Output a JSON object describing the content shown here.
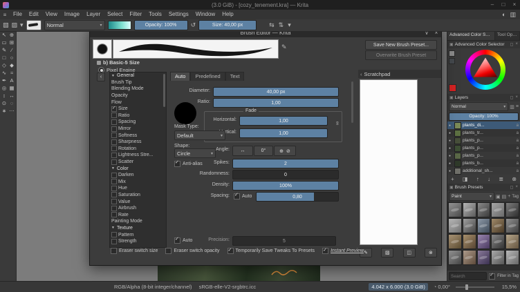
{
  "window": {
    "title": "(3.0 GiB) - [cozy_tenement.kra] — Krita",
    "controls": [
      {
        "glyph": "–",
        "name": "minimize"
      },
      {
        "glyph": "□",
        "name": "maximize"
      },
      {
        "glyph": "×",
        "name": "close"
      }
    ]
  },
  "menubar": {
    "items": [
      "File",
      "Edit",
      "View",
      "Image",
      "Layer",
      "Select",
      "Filter",
      "Tools",
      "Settings",
      "Window",
      "Help"
    ],
    "right_icons": [
      "◐",
      "▥"
    ]
  },
  "toolbar": {
    "left_icons": [
      "▧",
      "▨",
      "▾"
    ],
    "blend_mode": "Normal",
    "opacity_label": "Opacity: 100%",
    "opacity_fill": "100%",
    "size_label": "Size: 40,00 px",
    "size_fill": "100%",
    "right_icons": [
      "⇆",
      "⇅",
      "▾"
    ]
  },
  "toolbox": {
    "tools": [
      "↖",
      "⊕",
      "▭",
      "⊞",
      "✎",
      "∕",
      "□",
      "○",
      "◇",
      "◆",
      "∿",
      "≈",
      "✒",
      "A",
      "◎",
      "▦",
      "↕",
      "↔",
      "⊙",
      "◌",
      "∗",
      "⋯"
    ]
  },
  "dialog": {
    "title": "Brush Editor — Krita",
    "titlebar_icons": [
      {
        "glyph": "∨",
        "name": "detach"
      },
      {
        "glyph": "×",
        "name": "close"
      }
    ],
    "preset_name": "b) Basic-5 Size",
    "engine": "Pixel Engine",
    "save_button": "Save New Brush Preset...",
    "overwrite_button": "Overwrite Brush Preset",
    "options": [
      {
        "label": "General",
        "is_header": true
      },
      {
        "label": "Brush Tip"
      },
      {
        "label": "Blending Mode"
      },
      {
        "label": "Opacity"
      },
      {
        "label": "Flow"
      },
      {
        "label": "Size",
        "has_check": true,
        "checked": true
      },
      {
        "label": "Ratio",
        "has_check": true
      },
      {
        "label": "Spacing",
        "has_check": true
      },
      {
        "label": "Mirror",
        "has_check": true
      },
      {
        "label": "Softness",
        "has_check": true
      },
      {
        "label": "Sharpness",
        "has_check": true
      },
      {
        "label": "Rotation",
        "has_check": true
      },
      {
        "label": "Lightness Stre...",
        "has_check": true
      },
      {
        "label": "Scatter",
        "has_check": true
      },
      {
        "label": "Color",
        "is_header": true
      },
      {
        "label": "Darken",
        "has_check": true
      },
      {
        "label": "Mix",
        "has_check": true
      },
      {
        "label": "Hue",
        "has_check": true
      },
      {
        "label": "Saturation",
        "has_check": true
      },
      {
        "label": "Value",
        "has_check": true
      },
      {
        "label": "Airbrush",
        "has_check": true
      },
      {
        "label": "Rate",
        "has_check": true
      },
      {
        "label": "Painting Mode"
      },
      {
        "label": "Texture",
        "is_header": true
      },
      {
        "label": "Pattern",
        "has_check": true
      },
      {
        "label": "Strength",
        "has_check": true
      }
    ],
    "tabs": [
      {
        "label": "Auto",
        "active": true
      },
      {
        "label": "Predefined"
      },
      {
        "label": "Text"
      }
    ],
    "diameter": {
      "label": "Diameter:",
      "value": "40,00 px",
      "fill": "100%"
    },
    "ratio": {
      "label": "Ratio:",
      "value": "1,00",
      "fill": "100%"
    },
    "fade": {
      "title": "Fade",
      "horizontal": {
        "label": "Horizontal:",
        "value": "1,00",
        "fill": "100%"
      },
      "vertical": {
        "label": "Vertical:",
        "value": "1,00",
        "fill": "100%"
      }
    },
    "mask_type": {
      "label": "Mask Type:",
      "value": "Default"
    },
    "shape": {
      "label": "Shape:",
      "value": "Circle"
    },
    "antialias_label": "Anti-alias",
    "angle": {
      "label": "Angle:",
      "value": "0°"
    },
    "spikes": {
      "label": "Spikes:",
      "value": "2",
      "fill": "100%"
    },
    "randomness": {
      "label": "Randomness:",
      "value": "0",
      "fill": "0%"
    },
    "density": {
      "label": "Density:",
      "value": "100%",
      "fill": "100%"
    },
    "spacing": {
      "label": "Spacing:",
      "auto_label": "Auto",
      "value": "0,80",
      "fill": "70%"
    },
    "precision": {
      "auto_label": "Auto",
      "label": "Precision:",
      "value": "5",
      "fill": "0%"
    },
    "scratchpad": {
      "title": "Scratchpad",
      "buttons": [
        {
          "glyph": "✎",
          "name": "paint-in-scratchpad"
        },
        {
          "glyph": "▨",
          "name": "fill-gradient"
        },
        {
          "glyph": "◫",
          "name": "fill-background"
        },
        {
          "glyph": "⊗",
          "name": "reset-scratchpad"
        }
      ]
    },
    "footer": [
      {
        "label": "Eraser switch size"
      },
      {
        "label": "Eraser switch opacity"
      },
      {
        "label": "Temporarily Save Tweaks To Presets",
        "checked": true
      },
      {
        "label": "Instant Preview",
        "checked": true,
        "emph": true
      }
    ]
  },
  "right_panel": {
    "tabs": [
      {
        "label": "Advanced Color Sele...",
        "active": true
      },
      {
        "label": "Tool Opt..."
      }
    ],
    "color_selector": {
      "title": "Advanced Color Selector",
      "current_color": "#d22222"
    },
    "layers": {
      "title": "Layers",
      "blend_mode": "Normal",
      "opacity_label": "Opacity: 100%",
      "opacity_fill": "100%",
      "items": [
        {
          "name": "plants_di...",
          "thumb": "#7a8a57",
          "selected": true
        },
        {
          "name": "plants_tr...",
          "thumb": "#5d7042"
        },
        {
          "name": "plants_p...",
          "thumb": "#474f3a"
        },
        {
          "name": "plants_p...",
          "thumb": "#3e4f35"
        },
        {
          "name": "plants_p...",
          "thumb": "#5a6847"
        },
        {
          "name": "plants_b...",
          "thumb": "#2f3a2a"
        },
        {
          "name": "additional_sh...",
          "thumb": "#70706a"
        }
      ],
      "action_icons": [
        {
          "glyph": "+",
          "name": "add-layer"
        },
        {
          "glyph": "◨",
          "name": "duplicate-layer"
        },
        {
          "glyph": "↑",
          "name": "move-layer-up"
        },
        {
          "glyph": "↓",
          "name": "move-layer-down"
        },
        {
          "glyph": "≣",
          "name": "layer-properties"
        },
        {
          "glyph": "⊗",
          "name": "delete-layer"
        }
      ]
    },
    "brush_presets": {
      "title": "Brush Presets",
      "mode": "Paint",
      "toolbar_icons": [
        "▣",
        "▤",
        "+"
      ],
      "tag_label": "Tag",
      "search_placeholder": "Search",
      "filter_label": "Filter in Tag",
      "items": [
        {
          "bg": "linear-gradient(135deg,#9a9a9a,#4a4a4a)"
        },
        {
          "bg": "linear-gradient(135deg,#b5b5b5,#5a5a5a)"
        },
        {
          "bg": "linear-gradient(135deg,#8a8a8a,#3a3a3a)"
        },
        {
          "bg": "linear-gradient(135deg,#a5a5a5,#6a6a6a)"
        },
        {
          "bg": "linear-gradient(135deg,#7d7d7d,#2e2e2e)"
        },
        {
          "bg": "linear-gradient(135deg,#c0c0c0,#707070)"
        },
        {
          "bg": "linear-gradient(135deg,#9f9f9f,#454545)"
        },
        {
          "bg": "linear-gradient(135deg,#8e9aa8,#3e4a58)"
        },
        {
          "bg": "linear-gradient(135deg,#a08a6a,#4a3a26)"
        },
        {
          "bg": "linear-gradient(135deg,#909090,#404040)"
        },
        {
          "bg": "linear-gradient(135deg,#b09a7a,#5a4a30)"
        },
        {
          "bg": "linear-gradient(135deg,#a8906c,#564432)"
        },
        {
          "bg": "linear-gradient(135deg,#9a86b0,#4a3a60)"
        },
        {
          "bg": "linear-gradient(135deg,#888888,#333333)"
        },
        {
          "bg": "linear-gradient(135deg,#b5a58a,#655540)"
        },
        {
          "bg": "linear-gradient(135deg,#999999,#444444)"
        },
        {
          "bg": "linear-gradient(135deg,#ad9a8a,#5d4a3a)"
        },
        {
          "bg": "linear-gradient(135deg,#8a7a9a,#3a3050)"
        },
        {
          "bg": "linear-gradient(135deg,#aaaaaa,#555555)"
        },
        {
          "bg": "linear-gradient(135deg,#b8b8b8,#686868)"
        }
      ]
    }
  },
  "statusbar": {
    "profile": "RGB/Alpha (8-bit integer/channel)",
    "icc": "sRGB-elle-V2-srgbtrc.icc",
    "memory": "4.042 x 6.000 (3.0 GiB)",
    "angle": "0,00°",
    "zoom": "15,5%"
  },
  "colors": {
    "accent": "#5d81a3",
    "selection": "#3d5a78",
    "slider_fill": "#5d81a3"
  }
}
